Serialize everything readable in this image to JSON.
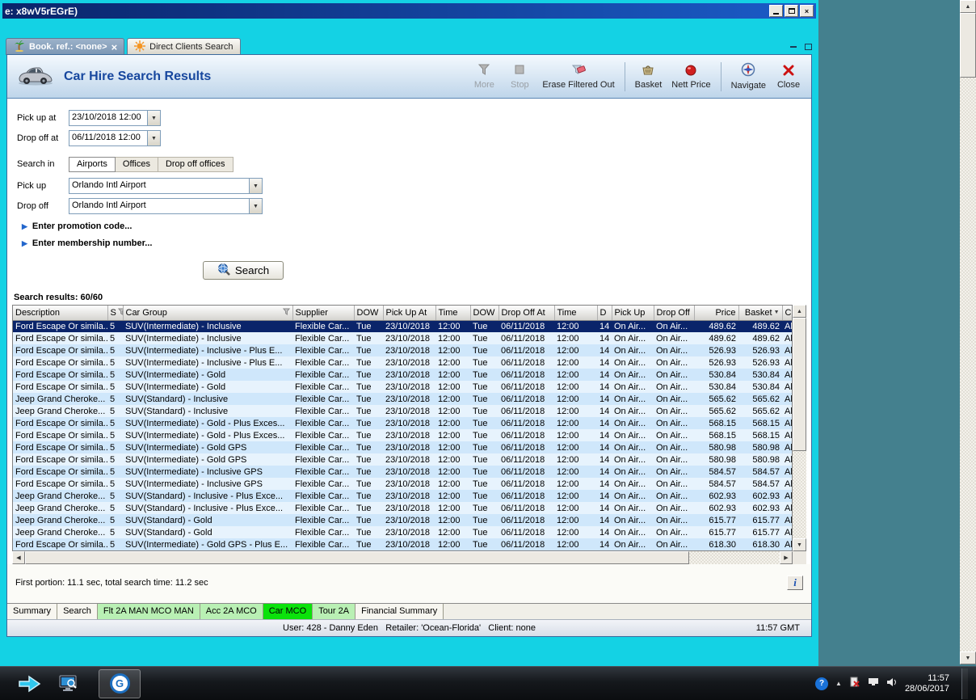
{
  "titlebar": {
    "title": "e: x8wV5rEGrE)"
  },
  "tabs": {
    "booking": "Book. ref.: <none>",
    "direct": "Direct Clients Search"
  },
  "header": {
    "title": "Car Hire Search Results",
    "toolbar": {
      "more": "More",
      "stop": "Stop",
      "erase": "Erase Filtered Out",
      "basket": "Basket",
      "nett": "Nett Price",
      "navigate": "Navigate",
      "close": "Close"
    }
  },
  "form": {
    "pickup_at_label": "Pick up at",
    "pickup_at_value": "23/10/2018 12:00",
    "dropoff_at_label": "Drop off at",
    "dropoff_at_value": "06/11/2018 12:00",
    "search_in_label": "Search in",
    "search_in_tabs": {
      "0": "Airports",
      "1": "Offices",
      "2": "Drop off offices"
    },
    "pickup_label": "Pick up",
    "pickup_value": "Orlando Intl Airport",
    "dropoff_label": "Drop off",
    "dropoff_value": "Orlando Intl Airport",
    "promo_toggle": "Enter promotion code...",
    "membership_toggle": "Enter membership number...",
    "search_button": "Search"
  },
  "results": {
    "summary": "Search results: 60/60",
    "selected_index": 0,
    "columns": [
      "Description",
      "S",
      "Car Group",
      "Supplier",
      "DOW",
      "Pick Up At",
      "Time",
      "DOW",
      "Drop Off At",
      "Time",
      "D",
      "Pick Up",
      "Drop Off",
      "Price",
      "Basket",
      "Ca"
    ],
    "rows": [
      [
        "Ford Escape Or simila...",
        "5",
        "SUV(Intermediate) - Inclusive",
        "Flexible Car...",
        "Tue",
        "23/10/2018",
        "12:00",
        "Tue",
        "06/11/2018",
        "12:00",
        "14",
        "On Air...",
        "On Air...",
        "489.62",
        "489.62",
        "Ala"
      ],
      [
        "Ford Escape Or simila...",
        "5",
        "SUV(Intermediate) - Inclusive",
        "Flexible Car...",
        "Tue",
        "23/10/2018",
        "12:00",
        "Tue",
        "06/11/2018",
        "12:00",
        "14",
        "On Air...",
        "On Air...",
        "489.62",
        "489.62",
        "Ala"
      ],
      [
        "Ford Escape Or simila...",
        "5",
        "SUV(Intermediate) - Inclusive - Plus E...",
        "Flexible Car...",
        "Tue",
        "23/10/2018",
        "12:00",
        "Tue",
        "06/11/2018",
        "12:00",
        "14",
        "On Air...",
        "On Air...",
        "526.93",
        "526.93",
        "Ala"
      ],
      [
        "Ford Escape Or simila...",
        "5",
        "SUV(Intermediate) - Inclusive - Plus E...",
        "Flexible Car...",
        "Tue",
        "23/10/2018",
        "12:00",
        "Tue",
        "06/11/2018",
        "12:00",
        "14",
        "On Air...",
        "On Air...",
        "526.93",
        "526.93",
        "Ala"
      ],
      [
        "Ford Escape Or simila...",
        "5",
        "SUV(Intermediate) - Gold",
        "Flexible Car...",
        "Tue",
        "23/10/2018",
        "12:00",
        "Tue",
        "06/11/2018",
        "12:00",
        "14",
        "On Air...",
        "On Air...",
        "530.84",
        "530.84",
        "Ala"
      ],
      [
        "Ford Escape Or simila...",
        "5",
        "SUV(Intermediate) - Gold",
        "Flexible Car...",
        "Tue",
        "23/10/2018",
        "12:00",
        "Tue",
        "06/11/2018",
        "12:00",
        "14",
        "On Air...",
        "On Air...",
        "530.84",
        "530.84",
        "Ala"
      ],
      [
        "Jeep Grand Cheroke...",
        "5",
        "SUV(Standard) - Inclusive",
        "Flexible Car...",
        "Tue",
        "23/10/2018",
        "12:00",
        "Tue",
        "06/11/2018",
        "12:00",
        "14",
        "On Air...",
        "On Air...",
        "565.62",
        "565.62",
        "Ala"
      ],
      [
        "Jeep Grand Cheroke...",
        "5",
        "SUV(Standard) - Inclusive",
        "Flexible Car...",
        "Tue",
        "23/10/2018",
        "12:00",
        "Tue",
        "06/11/2018",
        "12:00",
        "14",
        "On Air...",
        "On Air...",
        "565.62",
        "565.62",
        "Ala"
      ],
      [
        "Ford Escape Or simila...",
        "5",
        "SUV(Intermediate) - Gold - Plus Exces...",
        "Flexible Car...",
        "Tue",
        "23/10/2018",
        "12:00",
        "Tue",
        "06/11/2018",
        "12:00",
        "14",
        "On Air...",
        "On Air...",
        "568.15",
        "568.15",
        "Ala"
      ],
      [
        "Ford Escape Or simila...",
        "5",
        "SUV(Intermediate) - Gold - Plus Exces...",
        "Flexible Car...",
        "Tue",
        "23/10/2018",
        "12:00",
        "Tue",
        "06/11/2018",
        "12:00",
        "14",
        "On Air...",
        "On Air...",
        "568.15",
        "568.15",
        "Ala"
      ],
      [
        "Ford Escape Or simila...",
        "5",
        "SUV(Intermediate) - Gold GPS",
        "Flexible Car...",
        "Tue",
        "23/10/2018",
        "12:00",
        "Tue",
        "06/11/2018",
        "12:00",
        "14",
        "On Air...",
        "On Air...",
        "580.98",
        "580.98",
        "Ala"
      ],
      [
        "Ford Escape Or simila...",
        "5",
        "SUV(Intermediate) - Gold GPS",
        "Flexible Car...",
        "Tue",
        "23/10/2018",
        "12:00",
        "Tue",
        "06/11/2018",
        "12:00",
        "14",
        "On Air...",
        "On Air...",
        "580.98",
        "580.98",
        "Ala"
      ],
      [
        "Ford Escape Or simila...",
        "5",
        "SUV(Intermediate) - Inclusive GPS",
        "Flexible Car...",
        "Tue",
        "23/10/2018",
        "12:00",
        "Tue",
        "06/11/2018",
        "12:00",
        "14",
        "On Air...",
        "On Air...",
        "584.57",
        "584.57",
        "Ala"
      ],
      [
        "Ford Escape Or simila...",
        "5",
        "SUV(Intermediate) - Inclusive GPS",
        "Flexible Car...",
        "Tue",
        "23/10/2018",
        "12:00",
        "Tue",
        "06/11/2018",
        "12:00",
        "14",
        "On Air...",
        "On Air...",
        "584.57",
        "584.57",
        "Ala"
      ],
      [
        "Jeep Grand Cheroke...",
        "5",
        "SUV(Standard) - Inclusive - Plus Exce...",
        "Flexible Car...",
        "Tue",
        "23/10/2018",
        "12:00",
        "Tue",
        "06/11/2018",
        "12:00",
        "14",
        "On Air...",
        "On Air...",
        "602.93",
        "602.93",
        "Ala"
      ],
      [
        "Jeep Grand Cheroke...",
        "5",
        "SUV(Standard) - Inclusive - Plus Exce...",
        "Flexible Car...",
        "Tue",
        "23/10/2018",
        "12:00",
        "Tue",
        "06/11/2018",
        "12:00",
        "14",
        "On Air...",
        "On Air...",
        "602.93",
        "602.93",
        "Ala"
      ],
      [
        "Jeep Grand Cheroke...",
        "5",
        "SUV(Standard) - Gold",
        "Flexible Car...",
        "Tue",
        "23/10/2018",
        "12:00",
        "Tue",
        "06/11/2018",
        "12:00",
        "14",
        "On Air...",
        "On Air...",
        "615.77",
        "615.77",
        "Ala"
      ],
      [
        "Jeep Grand Cheroke...",
        "5",
        "SUV(Standard) - Gold",
        "Flexible Car...",
        "Tue",
        "23/10/2018",
        "12:00",
        "Tue",
        "06/11/2018",
        "12:00",
        "14",
        "On Air...",
        "On Air...",
        "615.77",
        "615.77",
        "Ala"
      ],
      [
        "Ford Escape Or simila...",
        "5",
        "SUV(Intermediate) - Gold GPS - Plus E...",
        "Flexible Car...",
        "Tue",
        "23/10/2018",
        "12:00",
        "Tue",
        "06/11/2018",
        "12:00",
        "14",
        "On Air...",
        "On Air...",
        "618.30",
        "618.30",
        "Ala"
      ]
    ]
  },
  "status_line": "First portion: 11.1 sec, total search time: 11.2 sec",
  "bottom_tabs": {
    "0": "Summary",
    "1": "Search",
    "2": "Flt 2A MAN MCO MAN",
    "3": "Acc 2A MCO",
    "4": "Car MCO",
    "5": "Tour 2A",
    "6": "Financial Summary"
  },
  "status_bar": {
    "text": "User: 428 - Danny Eden   Retailer: 'Ocean-Florida'   Client: none",
    "time": "11:57 GMT"
  },
  "taskbar": {
    "clock_time": "11:57",
    "clock_date": "28/06/2017"
  }
}
